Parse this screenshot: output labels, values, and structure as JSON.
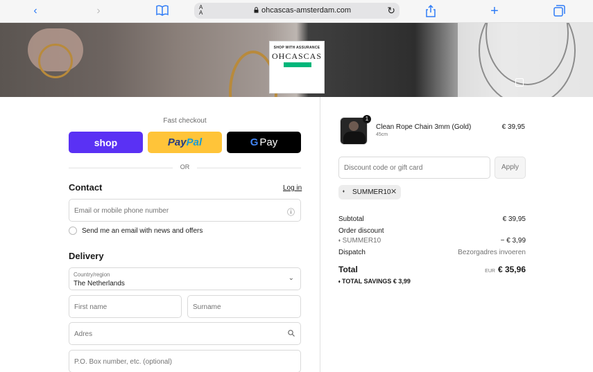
{
  "browser": {
    "url": "ohcascas-amsterdam.com",
    "aa_label": "AA"
  },
  "banner": {
    "logo_tagline": "SHOP WITH ASSURANCE",
    "logo_name": "OHCASCAS"
  },
  "checkout": {
    "fast_checkout_label": "Fast checkout",
    "shop_label": "shop",
    "paypal_label_1": "Pay",
    "paypal_label_2": "Pal",
    "gpay_label": "Pay",
    "or_label": "OR"
  },
  "contact": {
    "heading": "Contact",
    "login_label": "Log in",
    "email_placeholder": "Email or mobile phone number",
    "newsletter_label": "Send me an email with news and offers"
  },
  "delivery": {
    "heading": "Delivery",
    "country_label": "Country/region",
    "country_value": "The Netherlands",
    "first_name_placeholder": "First name",
    "surname_placeholder": "Surname",
    "address_placeholder": "Adres",
    "po_box_placeholder": "P.O. Box number, etc. (optional)"
  },
  "order": {
    "item": {
      "quantity": "1",
      "name": "Clean Rope Chain 3mm (Gold)",
      "variant": "45cm",
      "price": "€ 39,95"
    },
    "discount_placeholder": "Discount code or gift card",
    "apply_label": "Apply",
    "applied_code": "SUMMER10",
    "subtotal_label": "Subtotal",
    "subtotal_value": "€ 39,95",
    "order_discount_label": "Order discount",
    "discount_code_label": "SUMMER10",
    "discount_value": "− € 3,99",
    "dispatch_label": "Dispatch",
    "dispatch_value": "Bezorgadres invoeren",
    "total_label": "Total",
    "total_currency": "EUR",
    "total_value": "€ 35,96",
    "savings_label": "TOTAL SAVINGS",
    "savings_value": "€ 3,99"
  },
  "colors": {
    "shop_pay": "#5a31f4",
    "paypal": "#ffc439",
    "gpay": "#000000",
    "browser_accent": "#2f7cf6"
  }
}
